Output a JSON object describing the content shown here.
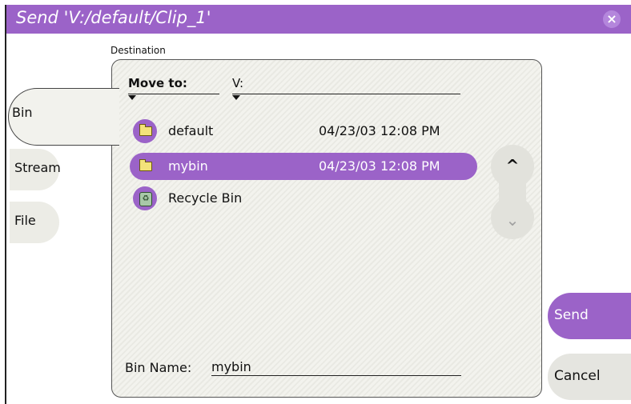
{
  "window": {
    "title": "Send 'V:/default/Clip_1'",
    "close_glyph": "×"
  },
  "destination_label": "Destination",
  "tabs": [
    {
      "label": "Bin",
      "selected": true
    },
    {
      "label": "Stream",
      "selected": false
    },
    {
      "label": "File",
      "selected": false
    }
  ],
  "move_to": {
    "label": "Move to:",
    "drive": "V:"
  },
  "bins": [
    {
      "name": "default",
      "date": "04/23/03 12:08 PM",
      "icon": "folder-icon",
      "selected": false
    },
    {
      "name": "mybin",
      "date": "04/23/03 12:08 PM",
      "icon": "folder-icon",
      "selected": true
    },
    {
      "name": "Recycle Bin",
      "date": "",
      "icon": "recycle-bin-icon",
      "selected": false
    }
  ],
  "scroll": {
    "up_glyph": "^",
    "down_glyph": "⌄"
  },
  "bin_name": {
    "label": "Bin Name:",
    "value": "mybin"
  },
  "buttons": {
    "send": "Send",
    "cancel": "Cancel"
  },
  "colors": {
    "accent": "#9b63c8",
    "panel": "#f0f0eb"
  }
}
